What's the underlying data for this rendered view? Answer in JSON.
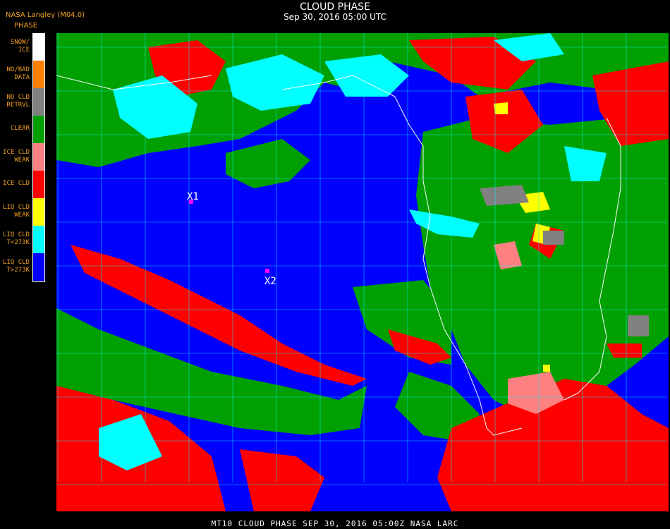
{
  "header": {
    "title": "CLOUD PHASE",
    "subtitle": "Sep 30, 2016 05:00 UTC",
    "provider": "NASA Langley (M04.0)",
    "legend_title": "PHASE"
  },
  "legend": [
    {
      "label1": "SNOW/",
      "label2": "ICE",
      "color": "#ffffff"
    },
    {
      "label1": "NO/BAD",
      "label2": "DATA",
      "color": "#ff8000"
    },
    {
      "label1": "NO CLD",
      "label2": "RETRVL",
      "color": "#808080"
    },
    {
      "label1": "CLEAR",
      "label2": "",
      "color": "#00a000"
    },
    {
      "label1": "ICE CLD",
      "label2": "WEAK",
      "color": "#ff8080"
    },
    {
      "label1": "ICE CLD",
      "label2": "",
      "color": "#ff0000"
    },
    {
      "label1": "LIQ CLD",
      "label2": "WEAK",
      "color": "#ffff00"
    },
    {
      "label1": "LIQ CLD",
      "label2": "T<273K",
      "color": "#00ffff"
    },
    {
      "label1": "LIQ CLD",
      "label2": "T>273K",
      "color": "#0000ff"
    }
  ],
  "markers": [
    {
      "label": "X1",
      "color": "#ff00ff"
    },
    {
      "label": "X2",
      "color": "#ff00ff"
    }
  ],
  "footer": "MT10  CLOUD PHASE   SEP 30, 2016 05:00Z   NASA LARC"
}
